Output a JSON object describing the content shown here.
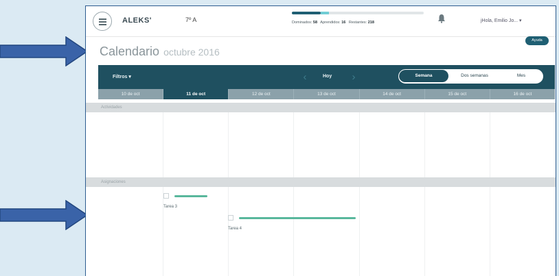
{
  "header": {
    "logo": "ALEKS'",
    "class_name": "7º A",
    "progress": {
      "fraction_dark": 0.22,
      "fraction_light": 0.28
    },
    "stats_label_1": "Dominados:",
    "stats_value_1": "58",
    "stats_label_2": "Aprendidos:",
    "stats_value_2": "16",
    "stats_label_3": "Restantes:",
    "stats_value_3": "218",
    "user": "jHola, Emilio Jo...  ▾"
  },
  "page": {
    "title": "Calendario",
    "month": "octubre 2016",
    "help_label": "Ayuda"
  },
  "toolbar": {
    "filters_label": "Filtros ▾",
    "prev_icon": "chevron-left-icon",
    "next_icon": "chevron-right-icon",
    "today_label": "Hoy",
    "views": [
      "Semana",
      "Dos semanas",
      "Mes"
    ]
  },
  "days": [
    "10 de oct",
    "11 de oct",
    "12 de oct",
    "13 de oct",
    "14 de oct",
    "15 de oct",
    "16 de oct"
  ],
  "sections": [
    "Actividades",
    "Asignaciones"
  ],
  "tasks": [
    "Tarea 3",
    "Tarea 4"
  ],
  "colors": {
    "accent": "#1f5060",
    "task": "#58b79c",
    "arrow": "#3a63a8"
  }
}
